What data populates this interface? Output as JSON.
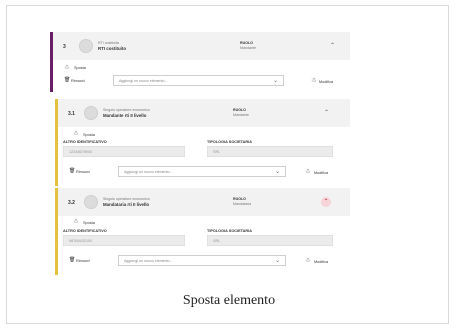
{
  "group_top": {
    "number": "3",
    "subtitle": "RTI costituita",
    "title": "RTI costituito",
    "role_label": "RUOLO",
    "role_value": "Mandante",
    "move_label": "Sposta",
    "remove_label": "Rimuovi",
    "select_placeholder": "Aggiungi un nuovo elemento...",
    "edit_label": "Modifica"
  },
  "member_1": {
    "number": "3.1",
    "subtitle": "Singolo operatore economico",
    "title": "Mandante rti II livello",
    "role_label": "RUOLO",
    "role_value": "Mandante",
    "move_label": "Sposta",
    "id_label": "ALTRO IDENTIFICATIVO",
    "id_value": "12345678900",
    "type_label": "TIPOLOGIA SOCIETARIA",
    "type_value": "SRL",
    "remove_label": "Rimuovi",
    "select_placeholder": "Aggiungi un nuovo elemento...",
    "edit_label": "Modifica"
  },
  "member_2": {
    "number": "3.2",
    "subtitle": "Singolo operatore economico",
    "title": "Mandataria rti II livello",
    "role_label": "RUOLO",
    "role_value": "Mandataria",
    "move_label": "Sposta",
    "id_label": "ALTRO IDENTIFICATIVO",
    "id_value": "98765432100",
    "type_label": "TIPOLOGIA SOCIETARIA",
    "type_value": "SRL",
    "remove_label": "Rimuovi",
    "select_placeholder": "Aggiungi un nuovo elemento...",
    "edit_label": "Modifica"
  },
  "caption": "Sposta elemento",
  "colors": {
    "group_bar": "#6b1e66",
    "member_bar": "#e5c23d",
    "highlight_chevron_bg": "#f6d4d8"
  }
}
